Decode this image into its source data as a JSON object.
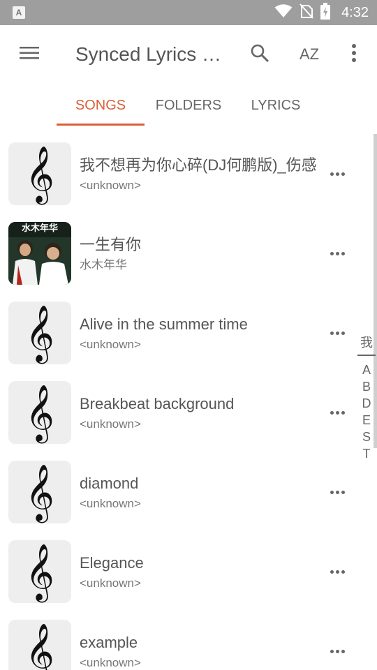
{
  "status_bar": {
    "time": "4:32",
    "icons": [
      "app-notification-icon",
      "wifi-icon",
      "no-sim-icon",
      "battery-charging-icon"
    ],
    "app_icon_letter": "A"
  },
  "toolbar": {
    "title": "Synced Lyrics Finder",
    "sort_label": "AZ",
    "icons": [
      "menu-icon",
      "search-icon",
      "sort-az-icon",
      "more-vert-icon"
    ]
  },
  "tabs": [
    {
      "label": "SONGS",
      "active": true
    },
    {
      "label": "FOLDERS",
      "active": false
    },
    {
      "label": "LYRICS",
      "active": false
    }
  ],
  "colors": {
    "accent": "#d9603b",
    "status_bar": "#9e9e9e",
    "thumb_bg": "#eeeeee"
  },
  "songs": [
    {
      "title": "我不想再为你心碎(DJ何鹏版)_伤感",
      "artist": "<unknown>",
      "art": "clef"
    },
    {
      "title": "一生有你",
      "artist": "水木年华",
      "art": "album",
      "album_text": "水木年华"
    },
    {
      "title": "Alive in the summer time",
      "artist": "<unknown>",
      "art": "clef"
    },
    {
      "title": "Breakbeat background",
      "artist": "<unknown>",
      "art": "clef"
    },
    {
      "title": "diamond",
      "artist": "<unknown>",
      "art": "clef"
    },
    {
      "title": "Elegance",
      "artist": "<unknown>",
      "art": "clef"
    },
    {
      "title": "example",
      "artist": "<unknown>",
      "art": "clef"
    }
  ],
  "index_letters": [
    "我",
    "A",
    "B",
    "D",
    "E",
    "S",
    "T"
  ]
}
